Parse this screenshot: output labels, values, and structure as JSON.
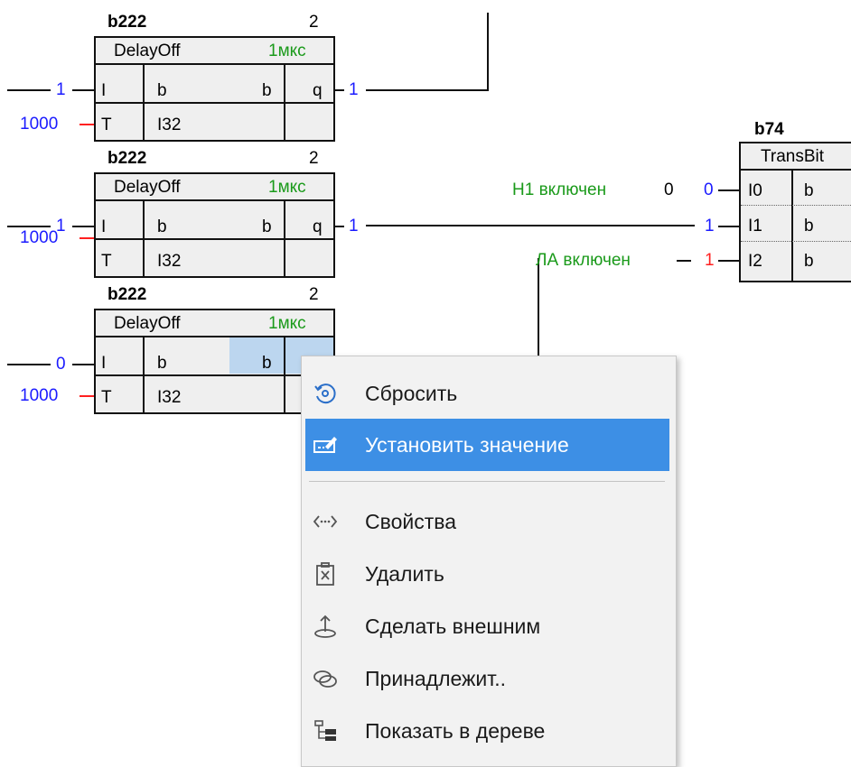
{
  "blocks": [
    {
      "name": "b222",
      "index": "2",
      "type": "DelayOff",
      "time": "1мкс",
      "in1": "I",
      "in1_type": "b",
      "out_type": "b",
      "out": "q",
      "in2": "T",
      "in2_type": "I32",
      "in1_value": "1",
      "in2_value": "1000",
      "out_value": "1"
    },
    {
      "name": "b222",
      "index": "2",
      "type": "DelayOff",
      "time": "1мкс",
      "in1": "I",
      "in1_type": "b",
      "out_type": "b",
      "out": "q",
      "in2": "T",
      "in2_type": "I32",
      "in1_value": "1",
      "in2_value": "1000",
      "out_value": "1"
    },
    {
      "name": "b222",
      "index": "2",
      "type": "DelayOff",
      "time": "1мкс",
      "in1": "I",
      "in1_type": "b",
      "out_type": "b",
      "in2": "T",
      "in2_type": "I32",
      "in1_value": "0",
      "in2_value": "1000"
    }
  ],
  "transbit": {
    "name": "b74",
    "type": "TransBit",
    "rows": [
      {
        "pin": "I0",
        "type": "b",
        "value": "0",
        "label": "Н1 включен",
        "label_value": "0"
      },
      {
        "pin": "I1",
        "type": "b",
        "value": "1"
      },
      {
        "pin": "I2",
        "type": "b",
        "value": "1",
        "label": "ЛА включен"
      }
    ]
  },
  "context_menu": {
    "items": [
      {
        "label": "Сбросить",
        "icon": "reset-icon",
        "active": false
      },
      {
        "label": "Установить значение",
        "icon": "set-value-icon",
        "active": true
      },
      {
        "label": "Свойства",
        "icon": "properties-icon",
        "active": false
      },
      {
        "label": "Удалить",
        "icon": "delete-icon",
        "active": false
      },
      {
        "label": "Сделать внешним",
        "icon": "make-external-icon",
        "active": false
      },
      {
        "label": "Принадлежит..",
        "icon": "belongs-icon",
        "active": false
      },
      {
        "label": "Показать в дереве",
        "icon": "tree-icon",
        "active": false
      }
    ]
  },
  "colors": {
    "value_blue": "#1b1bff",
    "value_red": "#ff1f1f",
    "label_green": "#1a9a1a",
    "menu_highlight": "#3d8fe5",
    "block_fill": "#efefef"
  }
}
